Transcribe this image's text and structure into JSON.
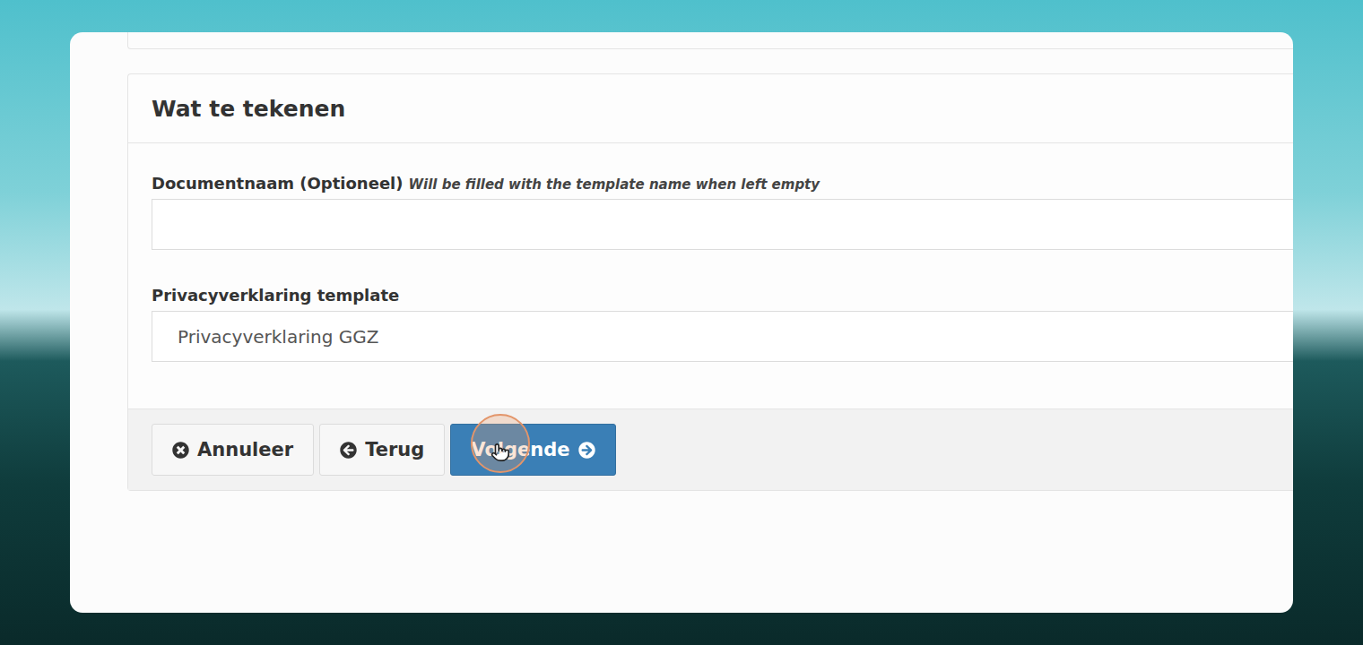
{
  "panel": {
    "title": "Wat te tekenen"
  },
  "fields": [
    {
      "label": "Documentnaam (Optioneel)",
      "hint": "Will be filled with the template name when left empty",
      "value": ""
    },
    {
      "label": "Privacyverklaring template",
      "hint": "",
      "value": "Privacyverklaring GGZ"
    }
  ],
  "buttons": [
    {
      "label": "Annuleer",
      "kind": "cancel",
      "primary": false,
      "hovered": false
    },
    {
      "label": "Terug",
      "kind": "back",
      "primary": false,
      "hovered": false
    },
    {
      "label": "Volgende",
      "kind": "next",
      "primary": true,
      "hovered": true
    }
  ]
}
